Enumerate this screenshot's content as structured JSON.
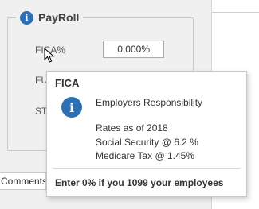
{
  "group": {
    "title": "PayRoll",
    "icon": "info-icon"
  },
  "fields": {
    "fica_label": "FICA%",
    "fica_value": "0.000%",
    "fu_label_partial": "FU",
    "st_label_partial": "ST"
  },
  "comments_tab": {
    "label": "Comments"
  },
  "tooltip": {
    "title": "FICA",
    "icon": "info-icon",
    "heading": "Employers Responsibility",
    "rates_line": "Rates as of 2018",
    "social_security": "Social Security @ 6.2 %",
    "medicare": "Medicare Tax @ 1.45%",
    "footer": "Enter 0% if you 1099 your employees"
  },
  "colors": {
    "accent": "#2b6fb6",
    "panel": "#f0f0f0"
  }
}
